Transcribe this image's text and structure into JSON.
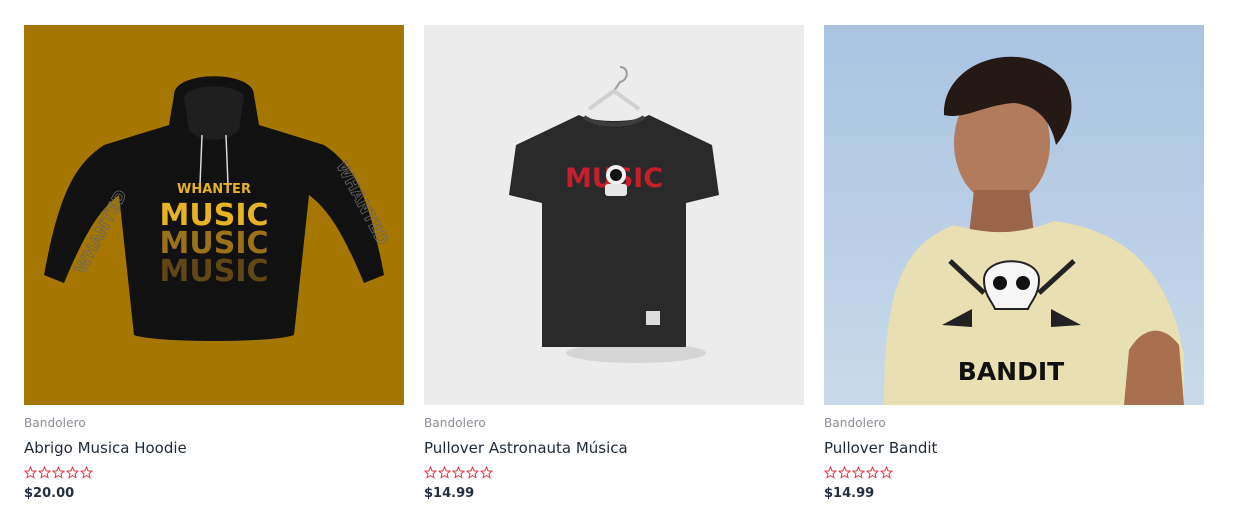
{
  "products": [
    {
      "brand": "Bandolero",
      "title": "Abrigo Musica Hoodie",
      "rating": 0,
      "price": "$20.00",
      "graphic": {
        "line1": "WHANTER",
        "line2": "MUSIC",
        "sleeve_text": "WHANTED",
        "background": "#a57600"
      }
    },
    {
      "brand": "Bandolero",
      "title": "Pullover Astronauta Música",
      "rating": 0,
      "price": "$14.99",
      "graphic": {
        "text": "MUSIC",
        "background": "#ececec",
        "text_color": "#c41f2b"
      }
    },
    {
      "brand": "Bandolero",
      "title": "Pullover Bandit",
      "rating": 0,
      "price": "$14.99",
      "graphic": {
        "text": "BANDIT",
        "background": "#b7cde6",
        "shirt_color": "#e8dfb2"
      }
    }
  ],
  "colors": {
    "star_outline": "#e4323b",
    "text": "#1f2a37",
    "muted": "#8a8f98"
  },
  "icons": {
    "rating_star": "star-outline-icon"
  }
}
